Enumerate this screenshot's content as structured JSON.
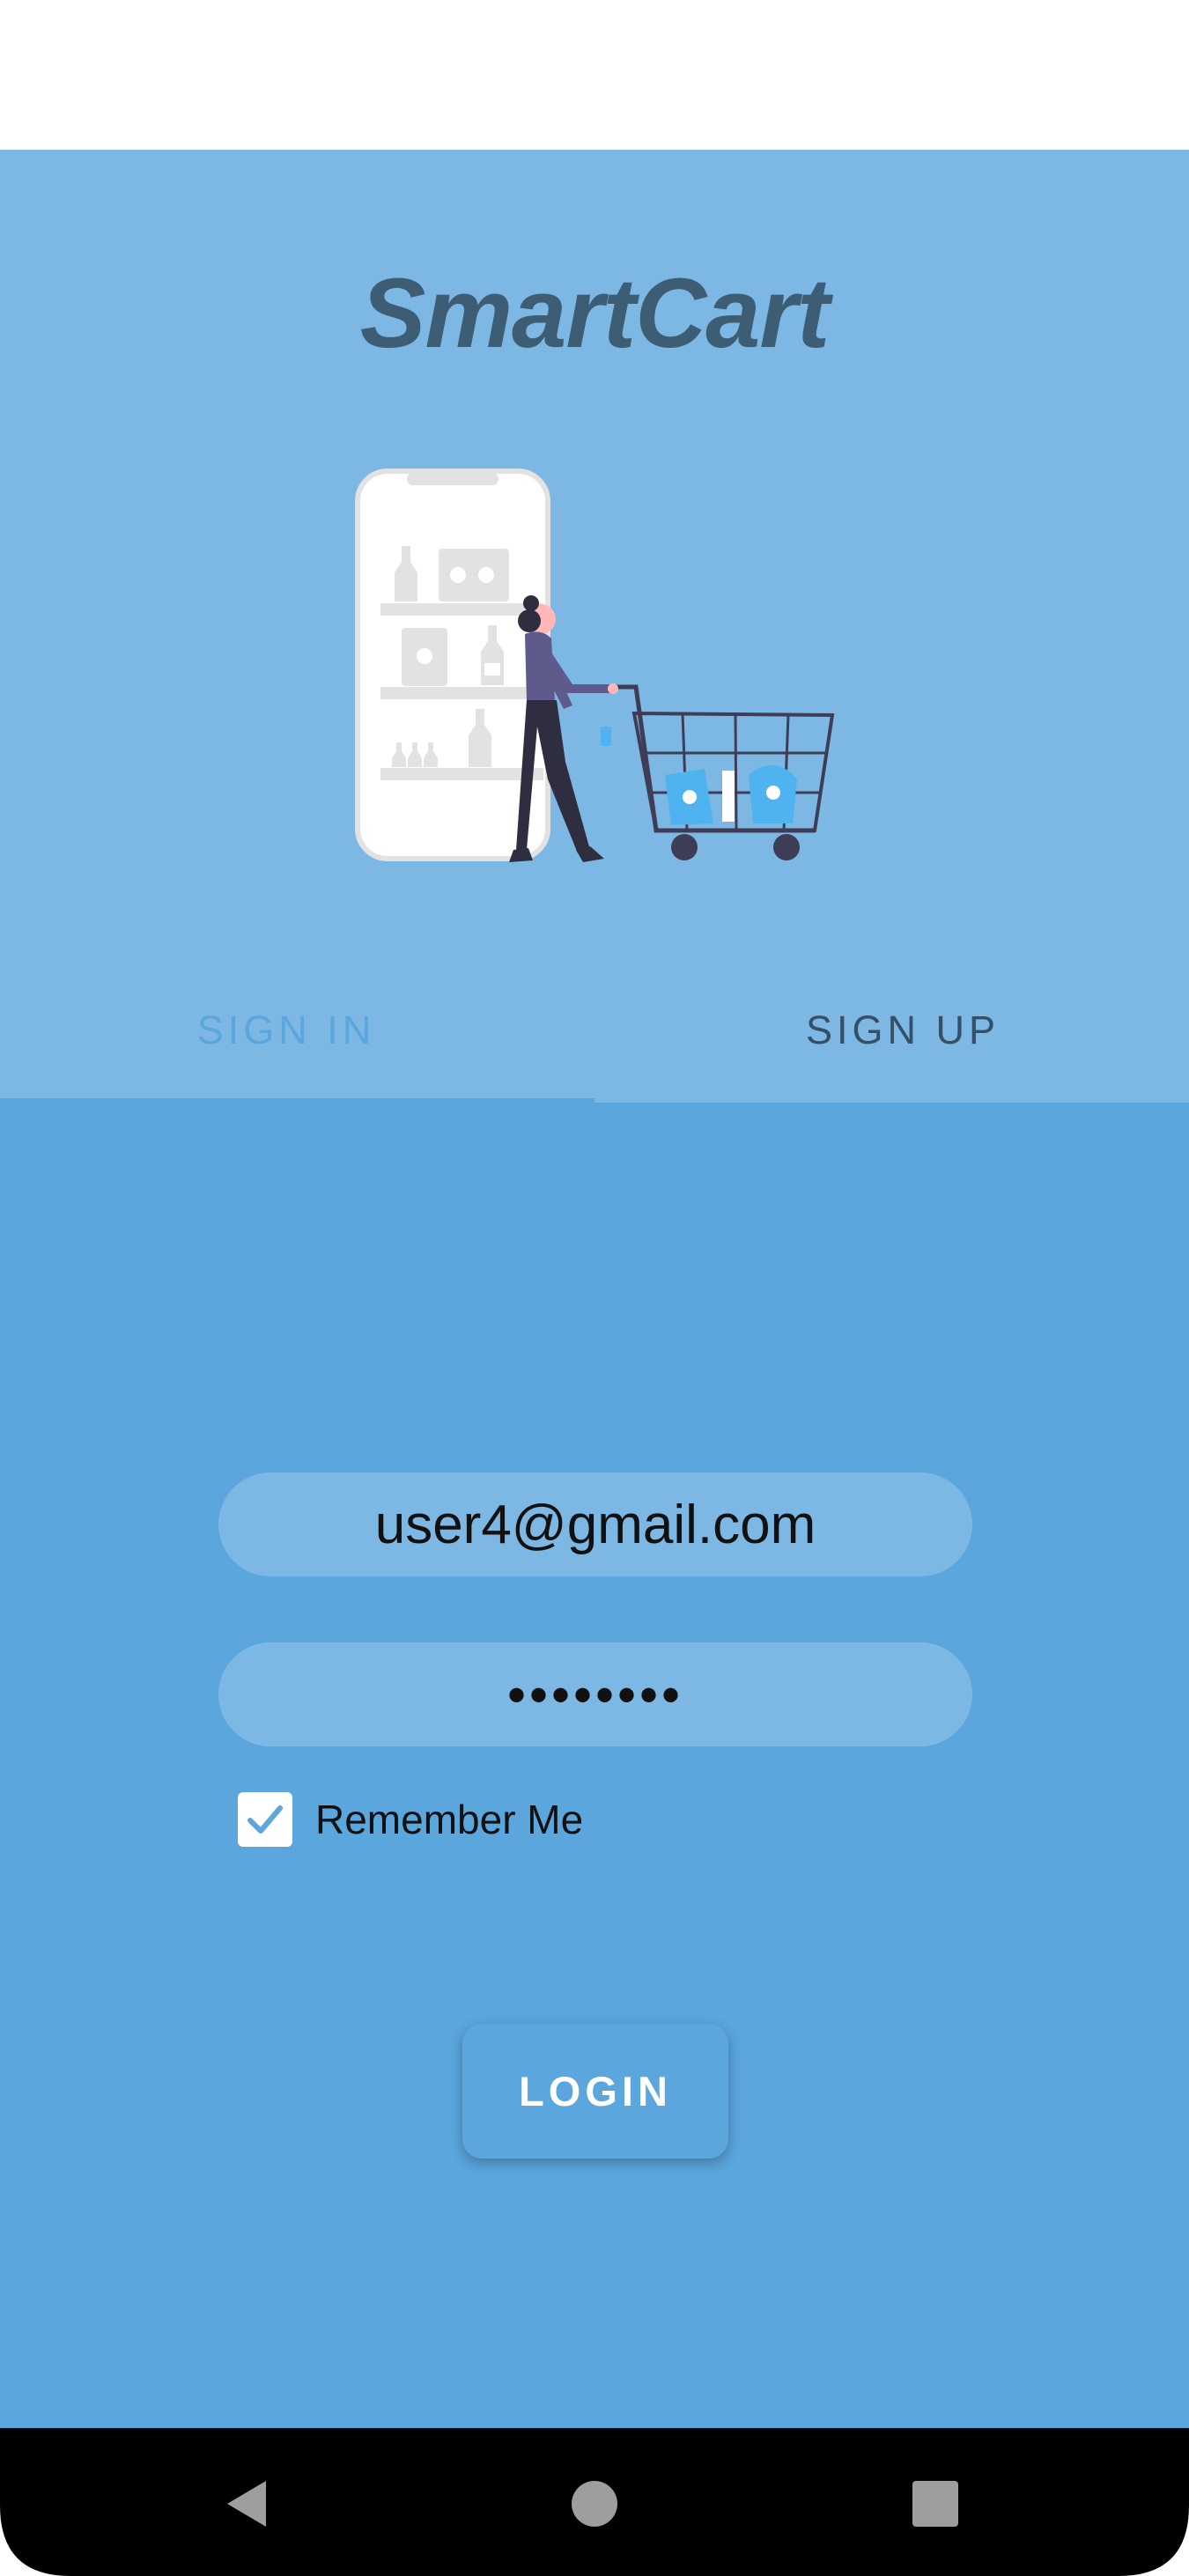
{
  "app": {
    "title": "SmartCart"
  },
  "tabs": [
    {
      "label": "SIGN IN",
      "active": true
    },
    {
      "label": "SIGN UP",
      "active": false
    }
  ],
  "form": {
    "email_value": "user4@gmail.com",
    "password_value": "••••••••",
    "remember_label": "Remember Me",
    "remember_checked": true,
    "login_label": "LOGIN"
  },
  "illustration": {
    "icon": "woman-shopping-cart-illustration"
  },
  "nav": {
    "back_icon": "back-triangle-icon",
    "home_icon": "home-circle-icon",
    "recent_icon": "recent-square-icon"
  },
  "colors": {
    "header_bg": "#7db8e5",
    "form_bg": "#5aa6dd",
    "title": "#3d5d75",
    "tab_active": "#5ba6dd",
    "tab_inactive": "#344f66",
    "input_bg": "#7db8e5",
    "button_text": "#ffffff"
  }
}
